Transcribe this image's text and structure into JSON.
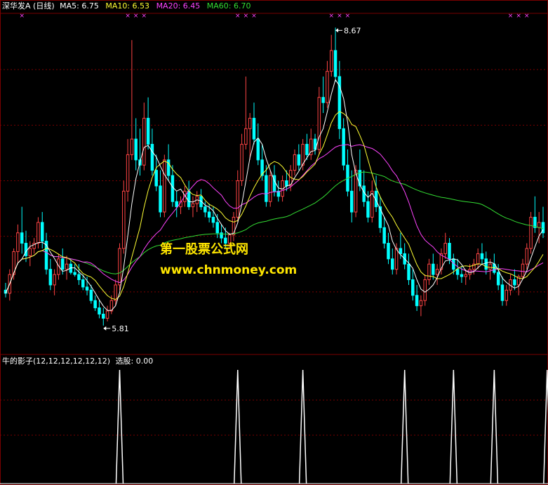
{
  "header": {
    "stock_name": "深华发A",
    "period": "(日线)",
    "ma": [
      {
        "label": "MA5: 6.75",
        "color": "#ffffff"
      },
      {
        "label": "MA10: 6.53",
        "color": "#ffff33"
      },
      {
        "label": "MA20: 6.45",
        "color": "#ff44ff"
      },
      {
        "label": "MA60: 6.70",
        "color": "#33dd33"
      }
    ]
  },
  "indicator": {
    "name": "牛的影子(12,12,12,12,12,12)",
    "value_label": "选股: 0.00"
  },
  "watermark": {
    "line1": "第一股票公式网",
    "line2": "www.chnmoney.com"
  },
  "colors": {
    "up": "#ff4444",
    "down": "#00ffff",
    "grid": "#7a0000",
    "marker": "#ff44ff",
    "signal": "#ffffff"
  },
  "chart_data": {
    "type": "candlestick",
    "ylim": [
      5.6,
      8.8
    ],
    "annotations": [
      {
        "label": "8.67",
        "value": 8.67,
        "index": 81,
        "kind": "high"
      },
      {
        "label": "5.81",
        "value": 5.81,
        "index": 24,
        "kind": "low"
      }
    ],
    "signal_indices": [
      28,
      57,
      73,
      98,
      110,
      120,
      133
    ],
    "marker_indices": [
      4,
      30,
      32,
      34,
      57,
      59,
      61,
      80,
      82,
      84,
      124,
      126,
      128,
      137
    ],
    "candles": [
      [
        6.15,
        6.22,
        6.08,
        6.12
      ],
      [
        6.12,
        6.35,
        6.05,
        6.3
      ],
      [
        6.3,
        6.55,
        6.25,
        6.52
      ],
      [
        6.52,
        6.78,
        6.4,
        6.7
      ],
      [
        6.7,
        6.95,
        6.5,
        6.6
      ],
      [
        6.6,
        6.72,
        6.42,
        6.48
      ],
      [
        6.48,
        6.62,
        6.38,
        6.55
      ],
      [
        6.55,
        6.65,
        6.5,
        6.6
      ],
      [
        6.6,
        6.85,
        6.55,
        6.8
      ],
      [
        6.8,
        6.9,
        6.55,
        6.62
      ],
      [
        6.62,
        6.7,
        6.3,
        6.35
      ],
      [
        6.35,
        6.45,
        6.15,
        6.2
      ],
      [
        6.2,
        6.35,
        6.1,
        6.3
      ],
      [
        6.3,
        6.5,
        6.25,
        6.45
      ],
      [
        6.45,
        6.55,
        6.3,
        6.35
      ],
      [
        6.35,
        6.48,
        6.25,
        6.4
      ],
      [
        6.4,
        6.45,
        6.3,
        6.32
      ],
      [
        6.32,
        6.4,
        6.28,
        6.3
      ],
      [
        6.3,
        6.4,
        6.2,
        6.25
      ],
      [
        6.25,
        6.3,
        6.15,
        6.18
      ],
      [
        6.18,
        6.28,
        6.1,
        6.15
      ],
      [
        6.15,
        6.2,
        6.02,
        6.05
      ],
      [
        6.05,
        6.1,
        5.95,
        5.98
      ],
      [
        5.98,
        6.05,
        5.88,
        5.92
      ],
      [
        5.92,
        5.98,
        5.81,
        5.88
      ],
      [
        5.88,
        6.0,
        5.85,
        5.95
      ],
      [
        5.95,
        6.1,
        5.92,
        6.05
      ],
      [
        6.05,
        6.25,
        6.0,
        6.2
      ],
      [
        6.2,
        6.6,
        6.15,
        6.55
      ],
      [
        6.55,
        7.2,
        6.5,
        7.1
      ],
      [
        7.1,
        7.6,
        7.0,
        7.45
      ],
      [
        7.45,
        8.55,
        7.4,
        7.6
      ],
      [
        7.6,
        7.8,
        7.3,
        7.4
      ],
      [
        7.4,
        7.7,
        7.25,
        7.35
      ],
      [
        7.35,
        7.95,
        7.3,
        7.8
      ],
      [
        7.8,
        8.0,
        7.5,
        7.55
      ],
      [
        7.55,
        7.7,
        7.25,
        7.3
      ],
      [
        7.3,
        7.45,
        7.1,
        7.15
      ],
      [
        7.15,
        7.3,
        6.85,
        6.9
      ],
      [
        6.9,
        7.45,
        6.85,
        7.4
      ],
      [
        7.4,
        7.55,
        7.2,
        7.25
      ],
      [
        7.25,
        7.35,
        6.95,
        7.0
      ],
      [
        7.0,
        7.1,
        6.85,
        6.95
      ],
      [
        6.95,
        7.05,
        6.88,
        7.0
      ],
      [
        7.0,
        7.15,
        6.95,
        7.1
      ],
      [
        7.1,
        7.2,
        6.92,
        6.95
      ],
      [
        6.95,
        7.05,
        6.85,
        6.98
      ],
      [
        6.98,
        7.1,
        6.9,
        7.05
      ],
      [
        7.05,
        7.12,
        6.92,
        6.95
      ],
      [
        6.95,
        7.0,
        6.85,
        6.9
      ],
      [
        6.9,
        6.98,
        6.8,
        6.85
      ],
      [
        6.85,
        6.95,
        6.75,
        6.8
      ],
      [
        6.8,
        6.88,
        6.65,
        6.7
      ],
      [
        6.7,
        6.78,
        6.6,
        6.65
      ],
      [
        6.65,
        6.75,
        6.55,
        6.6
      ],
      [
        6.6,
        6.7,
        6.55,
        6.68
      ],
      [
        6.68,
        6.9,
        6.62,
        6.85
      ],
      [
        6.85,
        7.3,
        6.8,
        7.2
      ],
      [
        7.2,
        7.65,
        7.15,
        7.55
      ],
      [
        7.55,
        8.2,
        7.5,
        7.7
      ],
      [
        7.7,
        7.85,
        7.4,
        7.8
      ],
      [
        7.8,
        7.95,
        7.55,
        7.6
      ],
      [
        7.6,
        7.75,
        7.35,
        7.4
      ],
      [
        7.4,
        7.55,
        7.2,
        7.25
      ],
      [
        7.25,
        7.35,
        6.95,
        7.0
      ],
      [
        7.0,
        7.3,
        6.95,
        7.25
      ],
      [
        7.25,
        7.35,
        7.05,
        7.1
      ],
      [
        7.1,
        7.2,
        7.0,
        7.05
      ],
      [
        7.05,
        7.25,
        7.0,
        7.2
      ],
      [
        7.2,
        7.3,
        7.1,
        7.15
      ],
      [
        7.15,
        7.35,
        7.1,
        7.3
      ],
      [
        7.3,
        7.5,
        7.25,
        7.45
      ],
      [
        7.45,
        7.55,
        7.3,
        7.35
      ],
      [
        7.35,
        7.6,
        7.3,
        7.55
      ],
      [
        7.55,
        7.65,
        7.4,
        7.45
      ],
      [
        7.45,
        7.7,
        7.4,
        7.6
      ],
      [
        7.6,
        7.65,
        7.45,
        7.5
      ],
      [
        7.5,
        8.1,
        7.45,
        8.0
      ],
      [
        8.0,
        8.2,
        7.85,
        7.95
      ],
      [
        7.95,
        8.35,
        7.9,
        8.25
      ],
      [
        8.25,
        8.6,
        8.2,
        8.45
      ],
      [
        8.45,
        8.67,
        8.15,
        8.2
      ],
      [
        8.2,
        8.35,
        7.6,
        7.7
      ],
      [
        7.7,
        7.8,
        7.3,
        7.35
      ],
      [
        7.35,
        7.5,
        7.05,
        7.1
      ],
      [
        7.1,
        7.3,
        6.8,
        6.9
      ],
      [
        6.9,
        7.35,
        6.85,
        7.3
      ],
      [
        7.3,
        7.5,
        7.1,
        7.15
      ],
      [
        7.15,
        7.3,
        6.95,
        7.0
      ],
      [
        7.0,
        7.1,
        6.8,
        6.85
      ],
      [
        6.85,
        7.2,
        6.8,
        7.1
      ],
      [
        7.1,
        7.25,
        6.9,
        6.95
      ],
      [
        6.95,
        7.05,
        6.7,
        6.75
      ],
      [
        6.75,
        6.85,
        6.55,
        6.6
      ],
      [
        6.6,
        6.7,
        6.4,
        6.45
      ],
      [
        6.45,
        6.55,
        6.3,
        6.35
      ],
      [
        6.35,
        6.6,
        6.3,
        6.55
      ],
      [
        6.55,
        6.7,
        6.45,
        6.5
      ],
      [
        6.5,
        6.6,
        6.35,
        6.4
      ],
      [
        6.4,
        6.5,
        6.2,
        6.25
      ],
      [
        6.25,
        6.35,
        6.05,
        6.1
      ],
      [
        6.1,
        6.2,
        5.95,
        6.0
      ],
      [
        6.0,
        6.1,
        5.9,
        6.05
      ],
      [
        6.05,
        6.3,
        6.0,
        6.25
      ],
      [
        6.25,
        6.45,
        6.2,
        6.4
      ],
      [
        6.4,
        6.5,
        6.25,
        6.3
      ],
      [
        6.3,
        6.4,
        6.2,
        6.35
      ],
      [
        6.35,
        6.55,
        6.3,
        6.5
      ],
      [
        6.5,
        6.7,
        6.45,
        6.6
      ],
      [
        6.6,
        6.65,
        6.4,
        6.45
      ],
      [
        6.45,
        6.5,
        6.3,
        6.35
      ],
      [
        6.35,
        6.45,
        6.25,
        6.3
      ],
      [
        6.3,
        6.38,
        6.22,
        6.28
      ],
      [
        6.28,
        6.35,
        6.2,
        6.3
      ],
      [
        6.3,
        6.4,
        6.25,
        6.35
      ],
      [
        6.35,
        6.45,
        6.3,
        6.4
      ],
      [
        6.4,
        6.55,
        6.35,
        6.5
      ],
      [
        6.5,
        6.6,
        6.4,
        6.45
      ],
      [
        6.45,
        6.52,
        6.3,
        6.35
      ],
      [
        6.35,
        6.45,
        6.25,
        6.4
      ],
      [
        6.4,
        6.5,
        6.3,
        6.32
      ],
      [
        6.32,
        6.4,
        6.15,
        6.2
      ],
      [
        6.2,
        6.28,
        6.0,
        6.05
      ],
      [
        6.05,
        6.2,
        6.0,
        6.15
      ],
      [
        6.15,
        6.3,
        6.1,
        6.25
      ],
      [
        6.25,
        6.35,
        6.15,
        6.2
      ],
      [
        6.2,
        6.3,
        6.1,
        6.28
      ],
      [
        6.28,
        6.45,
        6.25,
        6.4
      ],
      [
        6.4,
        6.6,
        6.35,
        6.55
      ],
      [
        6.55,
        6.9,
        6.5,
        6.85
      ],
      [
        6.85,
        7.05,
        6.7,
        6.75
      ],
      [
        6.75,
        6.9,
        6.6,
        6.8
      ],
      [
        6.8,
        6.95,
        6.65,
        6.7
      ]
    ]
  }
}
